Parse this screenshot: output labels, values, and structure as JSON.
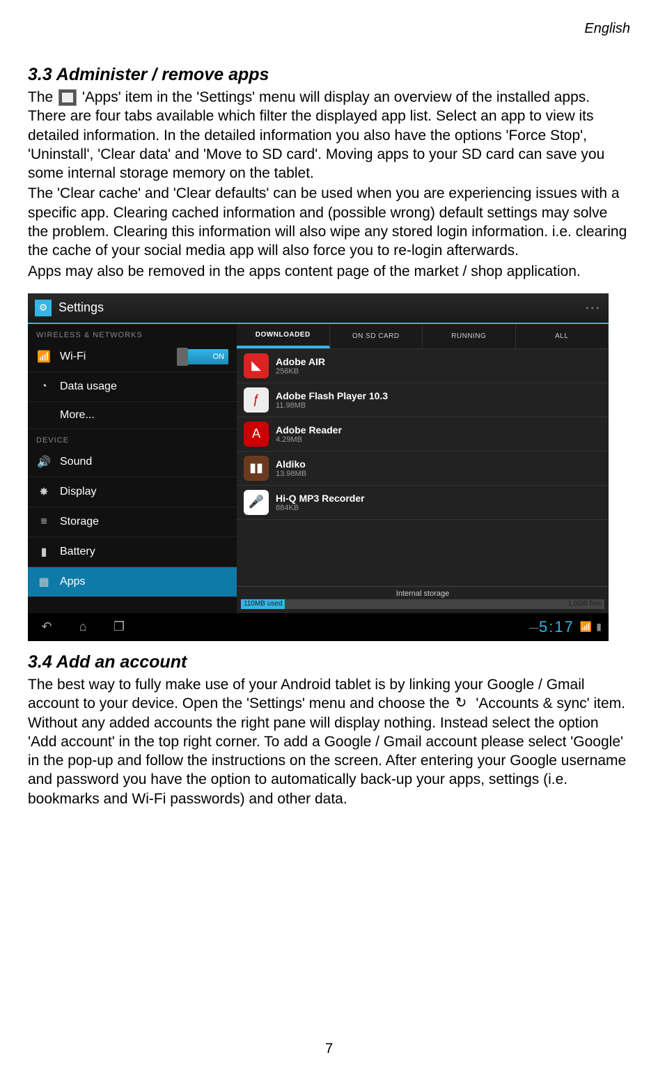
{
  "header_lang": "English",
  "section33": {
    "title": "3.3 Administer / remove apps",
    "p1_a": "The ",
    "p1_b": " 'Apps' item in the 'Settings' menu will display an overview of the installed apps. There are four tabs available which filter the displayed app list. Select an app to view its detailed information. In the detailed information you also have the options 'Force Stop', 'Uninstall', 'Clear data' and 'Move to SD card'. Moving apps to your SD card can save you some internal storage memory on the tablet.",
    "p2": "The 'Clear cache' and 'Clear defaults' can be used when you are experiencing issues with a specific app. Clearing cached information and (possible wrong) default settings may solve the problem. Clearing this information will also wipe any stored login information. i.e. clearing the cache of your social media app will also force you to re-login afterwards.",
    "p3": "Apps may also be removed in the apps content page of the market / shop application."
  },
  "screenshot": {
    "title": "Settings",
    "overflow": "⋮",
    "left": {
      "section1": "WIRELESS & NETWORKS",
      "wifi": "Wi-Fi",
      "wifi_toggle": "ON",
      "data": "Data usage",
      "more": "More...",
      "section2": "DEVICE",
      "sound": "Sound",
      "display": "Display",
      "storage": "Storage",
      "battery": "Battery",
      "apps": "Apps"
    },
    "tabs": {
      "t1": "DOWNLOADED",
      "t2": "ON SD CARD",
      "t3": "RUNNING",
      "t4": "ALL"
    },
    "applist": [
      {
        "name": "Adobe AIR",
        "size": "256KB",
        "bg": "#d22",
        "glyph": "◣"
      },
      {
        "name": "Adobe Flash Player 10.3",
        "size": "11.98MB",
        "bg": "#eee",
        "glyph": "ƒ"
      },
      {
        "name": "Adobe Reader",
        "size": "4.29MB",
        "bg": "#c00",
        "glyph": "A"
      },
      {
        "name": "Aldiko",
        "size": "13.98MB",
        "bg": "#6b3a1e",
        "glyph": "▮▮"
      },
      {
        "name": "Hi-Q MP3 Recorder",
        "size": "884KB",
        "bg": "#fff",
        "glyph": "🎤"
      }
    ],
    "storage": {
      "title": "Internal storage",
      "used": "110MB used",
      "free": "1.0GB free"
    },
    "nav": {
      "clock": "5:17"
    }
  },
  "section34": {
    "title": "3.4 Add an account",
    "p1_a": "The best way to fully make use of your Android tablet is by linking your Google / Gmail account to your device. Open the 'Settings' menu and choose the ",
    "p1_b": " 'Accounts & sync' item. Without any added accounts the right pane will display nothing. Instead select the option 'Add account' in the top right corner. To add a Google / Gmail account please select 'Google' in the pop-up and follow the instructions on the screen. After entering your Google username and password you have the option to automatically back-up your apps, settings (i.e. bookmarks and Wi-Fi passwords) and other data."
  },
  "page_number": "7"
}
